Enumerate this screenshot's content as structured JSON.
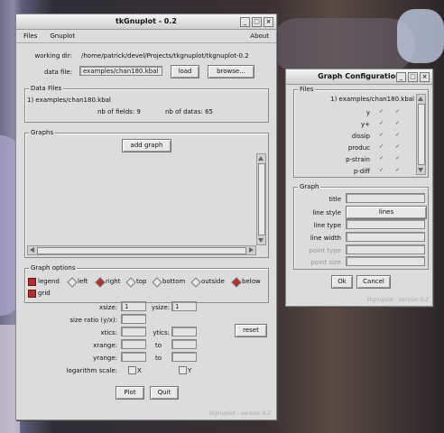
{
  "main": {
    "title": "tkGnuplot - 0.2",
    "menu": {
      "files": "Files",
      "gnuplot": "Gnuplot",
      "about": "About"
    },
    "working_dir_label": "working dir:",
    "working_dir_value": "/home/patrick/devel/Projects/tkgnuplot/tkgnuplot-0.2",
    "data_file_label": "data file:",
    "data_file_value": "examples/chan180.kbal",
    "load_label": "load",
    "browse_label": "browse...",
    "data_files": {
      "title": "Data Files",
      "entry": "1) examples/chan180.kbal",
      "nb_fields_label": "nb of fields: 9",
      "nb_datas_label": "nb of datas: 65"
    },
    "graphs": {
      "title": "Graphs",
      "add_label": "add graph"
    },
    "graph_options": {
      "title": "Graph options",
      "legend": "legend",
      "left": "left",
      "right": "right",
      "top": "top",
      "bottom": "bottom",
      "outside": "outside",
      "below": "below",
      "grid": "grid",
      "xsize_label": "xsize:",
      "xsize_value": "1",
      "ysize_label": "ysize:",
      "ysize_value": "1",
      "size_ratio_label": "size ratio (y/x):",
      "xtics_label": "xtics:",
      "ytics_label": "ytics:",
      "reset_label": "reset",
      "xrange_label": "xrange:",
      "yrange_label": "yrange:",
      "to_label": "to",
      "log_label": "logarithm scale:",
      "log_x": "X",
      "log_y": "Y"
    },
    "plot_label": "Plot",
    "quit_label": "Quit",
    "footer": "tkgnuplot - version 0.2"
  },
  "config": {
    "title": "Graph Configuration",
    "files_title": "Files",
    "file_entry": "1) examples/chan180.kbal",
    "fields": [
      "y",
      "y+",
      "dissip",
      "produc",
      "p-strain",
      "p-diff"
    ],
    "graph_title": "Graph",
    "title_label": "title",
    "line_style_label": "line style",
    "line_style_value": "lines",
    "line_type_label": "line type",
    "line_width_label": "line width",
    "point_type_label": "point type",
    "point_size_label": "point size",
    "ok_label": "Ok",
    "cancel_label": "Cancel",
    "footer": "tkgnuplot - version 0.2"
  }
}
